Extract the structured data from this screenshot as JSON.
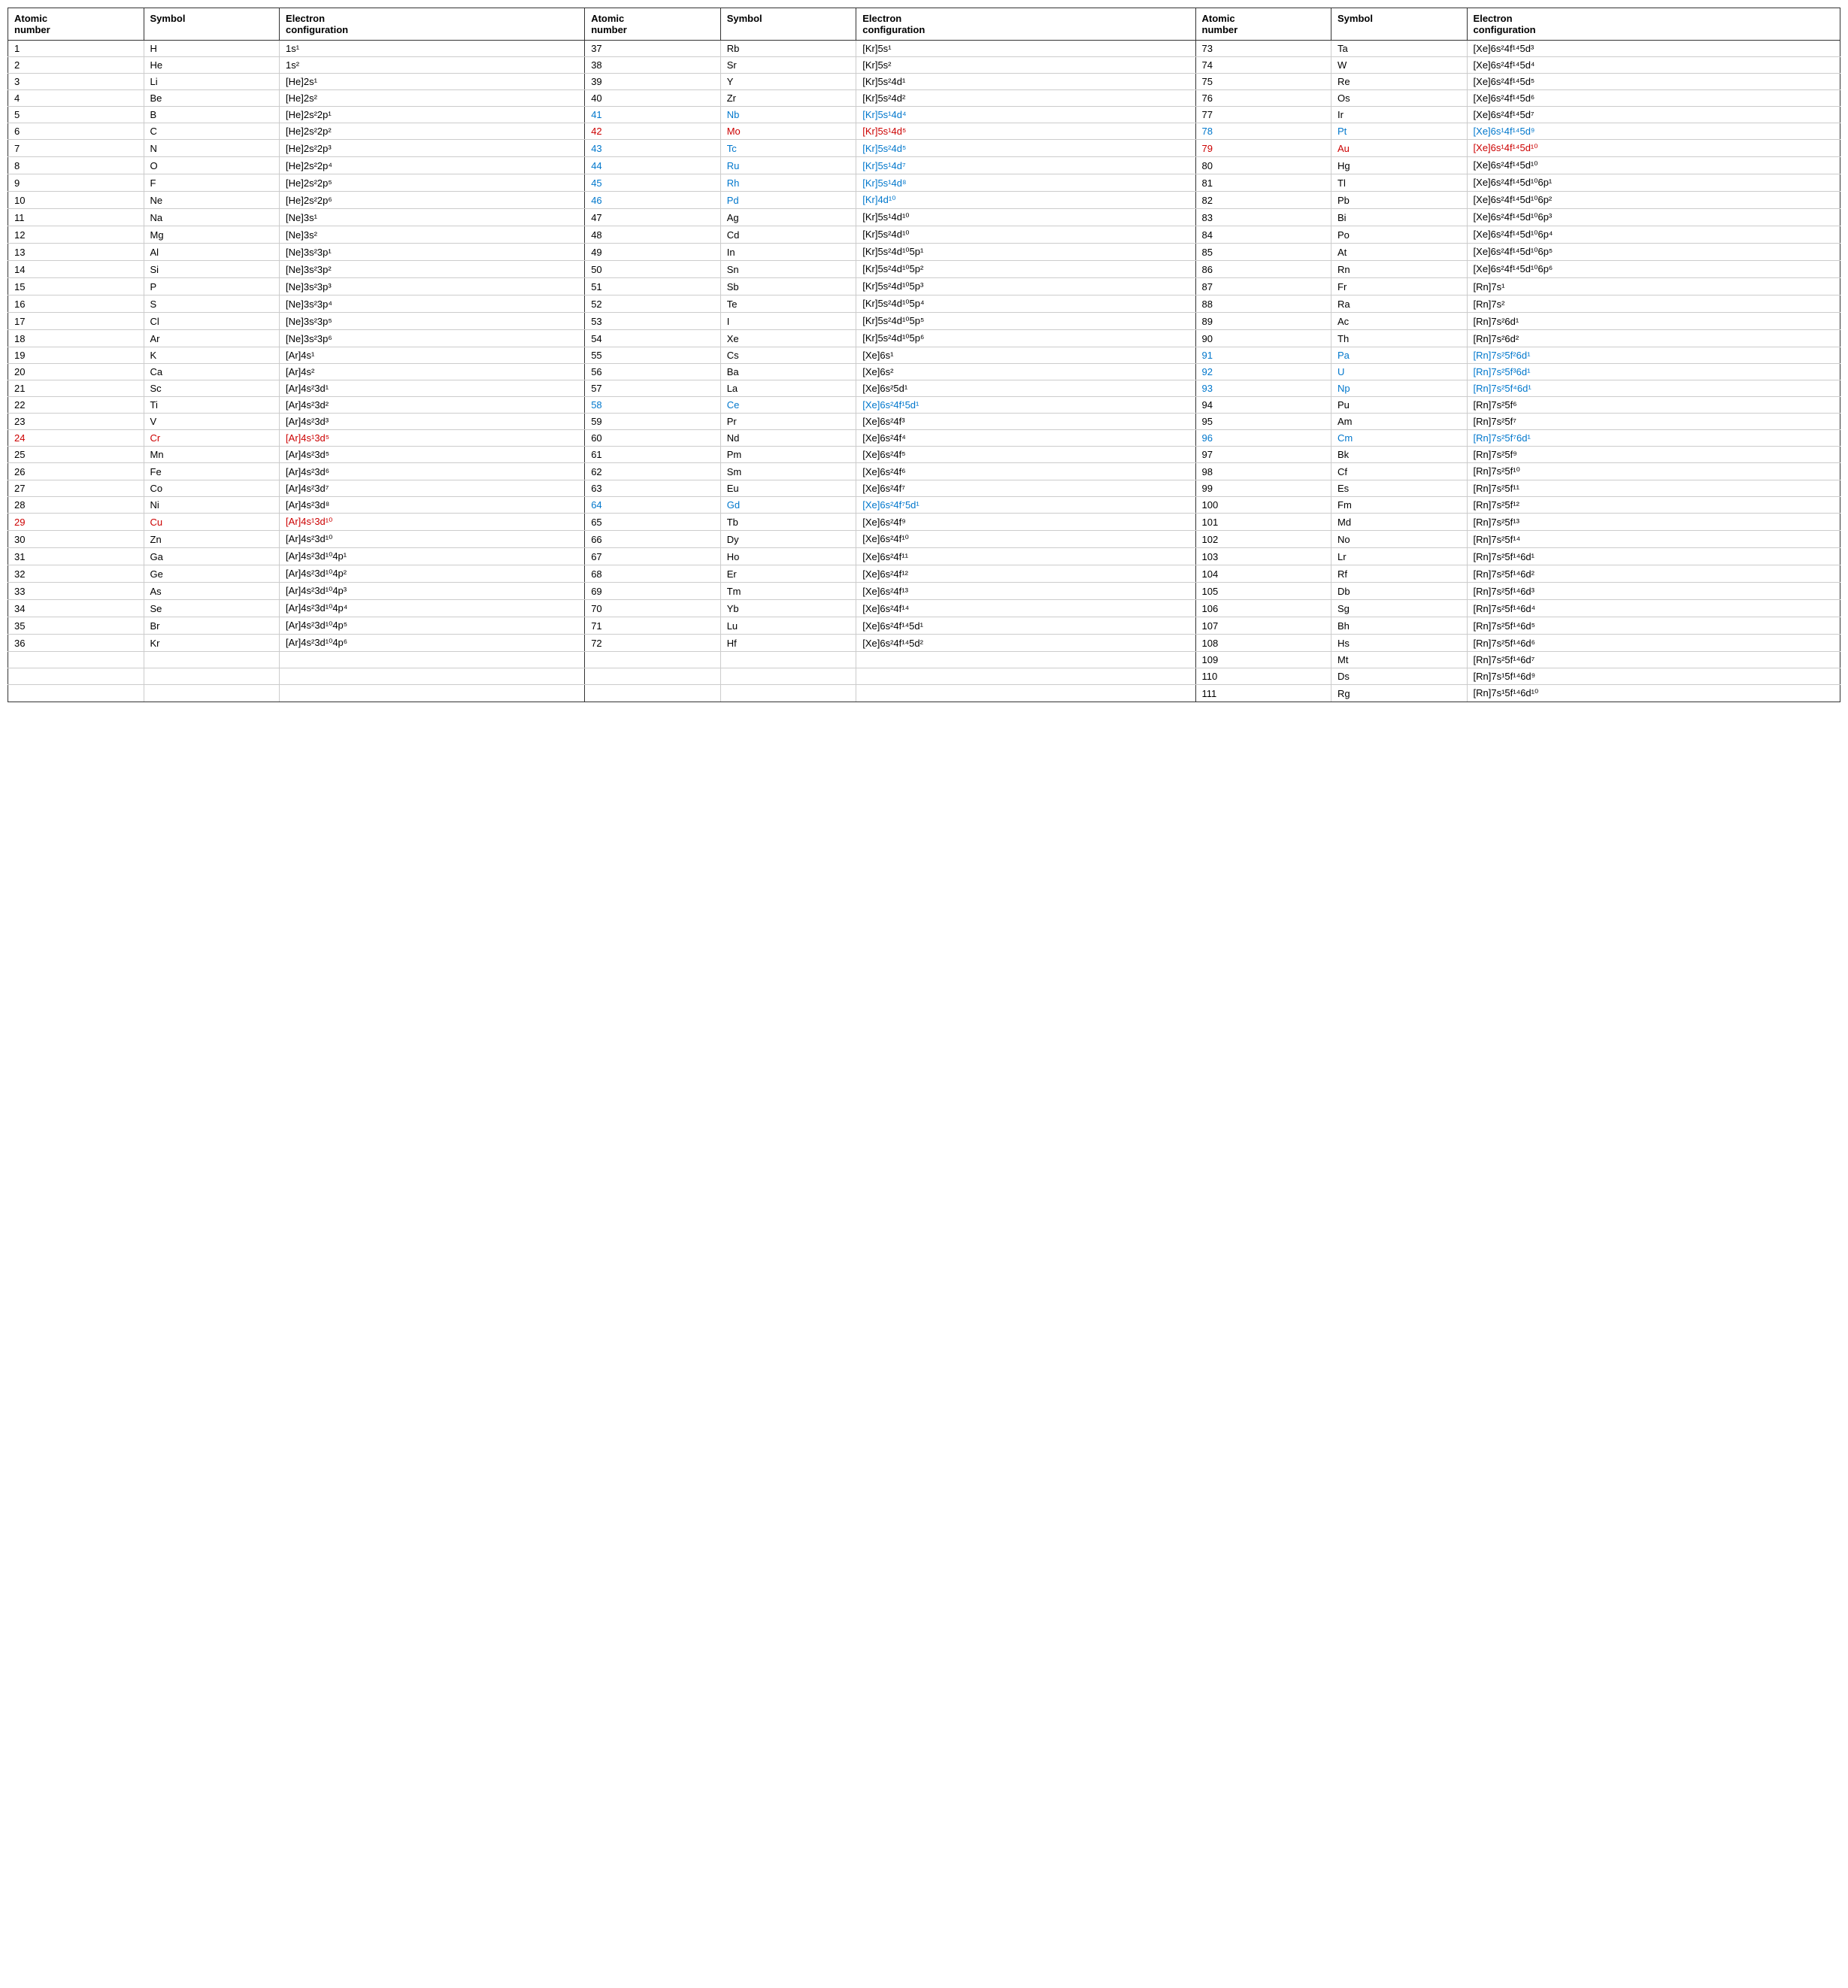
{
  "headers": {
    "col1": [
      "Atomic number",
      "Symbol",
      "Electron configuration"
    ],
    "col2": [
      "Atomic number",
      "Symbol",
      "Electron configuration"
    ],
    "col3": [
      "Atomic number",
      "Symbol",
      "Electron configuration"
    ]
  },
  "rows": [
    {
      "n1": "1",
      "s1": "H",
      "e1": "1s¹",
      "n2": "37",
      "s2": "Rb",
      "e2": "[Kr]5s¹",
      "n3": "73",
      "s3": "Ta",
      "e3": "[Xe]6s²4f¹⁴5d³",
      "c1": "normal",
      "c2": "normal",
      "c3": "normal"
    },
    {
      "n1": "2",
      "s1": "He",
      "e1": "1s²",
      "n2": "38",
      "s2": "Sr",
      "e2": "[Kr]5s²",
      "n3": "74",
      "s3": "W",
      "e3": "[Xe]6s²4f¹⁴5d⁴",
      "c1": "normal",
      "c2": "normal",
      "c3": "normal"
    },
    {
      "n1": "3",
      "s1": "Li",
      "e1": "[He]2s¹",
      "n2": "39",
      "s2": "Y",
      "e2": "[Kr]5s²4d¹",
      "n3": "75",
      "s3": "Re",
      "e3": "[Xe]6s²4f¹⁴5d⁵",
      "c1": "normal",
      "c2": "normal",
      "c3": "normal"
    },
    {
      "n1": "4",
      "s1": "Be",
      "e1": "[He]2s²",
      "n2": "40",
      "s2": "Zr",
      "e2": "[Kr]5s²4d²",
      "n3": "76",
      "s3": "Os",
      "e3": "[Xe]6s²4f¹⁴5d⁶",
      "c1": "normal",
      "c2": "normal",
      "c3": "normal"
    },
    {
      "n1": "5",
      "s1": "B",
      "e1": "[He]2s²2p¹",
      "n2": "41",
      "s2": "Nb",
      "e2": "[Kr]5s¹4d⁴",
      "n3": "77",
      "s3": "Ir",
      "e3": "[Xe]6s²4f¹⁴5d⁷",
      "c1": "normal",
      "c2": "blue",
      "c3": "normal"
    },
    {
      "n1": "6",
      "s1": "C",
      "e1": "[He]2s²2p²",
      "n2": "42",
      "s2": "Mo",
      "e2": "[Kr]5s¹4d⁵",
      "n3": "78",
      "s3": "Pt",
      "e3": "[Xe]6s¹4f¹⁴5d⁹",
      "c1": "normal",
      "c2": "red",
      "c3": "blue"
    },
    {
      "n1": "7",
      "s1": "N",
      "e1": "[He]2s²2p³",
      "n2": "43",
      "s2": "Tc",
      "e2": "[Kr]5s²4d⁵",
      "n3": "79",
      "s3": "Au",
      "e3": "[Xe]6s¹4f¹⁴5d¹⁰",
      "c1": "normal",
      "c2": "blue",
      "c3": "red"
    },
    {
      "n1": "8",
      "s1": "O",
      "e1": "[He]2s²2p⁴",
      "n2": "44",
      "s2": "Ru",
      "e2": "[Kr]5s¹4d⁷",
      "n3": "80",
      "s3": "Hg",
      "e3": "[Xe]6s²4f¹⁴5d¹⁰",
      "c1": "normal",
      "c2": "blue",
      "c3": "normal"
    },
    {
      "n1": "9",
      "s1": "F",
      "e1": "[He]2s²2p⁵",
      "n2": "45",
      "s2": "Rh",
      "e2": "[Kr]5s¹4d⁸",
      "n3": "81",
      "s3": "Tl",
      "e3": "[Xe]6s²4f¹⁴5d¹⁰6p¹",
      "c1": "normal",
      "c2": "blue",
      "c3": "normal"
    },
    {
      "n1": "10",
      "s1": "Ne",
      "e1": "[He]2s²2p⁶",
      "n2": "46",
      "s2": "Pd",
      "e2": "[Kr]4d¹⁰",
      "n3": "82",
      "s3": "Pb",
      "e3": "[Xe]6s²4f¹⁴5d¹⁰6p²",
      "c1": "normal",
      "c2": "blue",
      "c3": "normal"
    },
    {
      "n1": "11",
      "s1": "Na",
      "e1": "[Ne]3s¹",
      "n2": "47",
      "s2": "Ag",
      "e2": "[Kr]5s¹4d¹⁰",
      "n3": "83",
      "s3": "Bi",
      "e3": "[Xe]6s²4f¹⁴5d¹⁰6p³",
      "c1": "normal",
      "c2": "normal",
      "c3": "normal"
    },
    {
      "n1": "12",
      "s1": "Mg",
      "e1": "[Ne]3s²",
      "n2": "48",
      "s2": "Cd",
      "e2": "[Kr]5s²4d¹⁰",
      "n3": "84",
      "s3": "Po",
      "e3": "[Xe]6s²4f¹⁴5d¹⁰6p⁴",
      "c1": "normal",
      "c2": "normal",
      "c3": "normal"
    },
    {
      "n1": "13",
      "s1": "Al",
      "e1": "[Ne]3s²3p¹",
      "n2": "49",
      "s2": "In",
      "e2": "[Kr]5s²4d¹⁰5p¹",
      "n3": "85",
      "s3": "At",
      "e3": "[Xe]6s²4f¹⁴5d¹⁰6p⁵",
      "c1": "normal",
      "c2": "normal",
      "c3": "normal"
    },
    {
      "n1": "14",
      "s1": "Si",
      "e1": "[Ne]3s²3p²",
      "n2": "50",
      "s2": "Sn",
      "e2": "[Kr]5s²4d¹⁰5p²",
      "n3": "86",
      "s3": "Rn",
      "e3": "[Xe]6s²4f¹⁴5d¹⁰6p⁶",
      "c1": "normal",
      "c2": "normal",
      "c3": "normal"
    },
    {
      "n1": "15",
      "s1": "P",
      "e1": "[Ne]3s²3p³",
      "n2": "51",
      "s2": "Sb",
      "e2": "[Kr]5s²4d¹⁰5p³",
      "n3": "87",
      "s3": "Fr",
      "e3": "[Rn]7s¹",
      "c1": "normal",
      "c2": "normal",
      "c3": "normal"
    },
    {
      "n1": "16",
      "s1": "S",
      "e1": "[Ne]3s²3p⁴",
      "n2": "52",
      "s2": "Te",
      "e2": "[Kr]5s²4d¹⁰5p⁴",
      "n3": "88",
      "s3": "Ra",
      "e3": "[Rn]7s²",
      "c1": "normal",
      "c2": "normal",
      "c3": "normal"
    },
    {
      "n1": "17",
      "s1": "Cl",
      "e1": "[Ne]3s²3p⁵",
      "n2": "53",
      "s2": "I",
      "e2": "[Kr]5s²4d¹⁰5p⁵",
      "n3": "89",
      "s3": "Ac",
      "e3": "[Rn]7s²6d¹",
      "c1": "normal",
      "c2": "normal",
      "c3": "normal"
    },
    {
      "n1": "18",
      "s1": "Ar",
      "e1": "[Ne]3s²3p⁶",
      "n2": "54",
      "s2": "Xe",
      "e2": "[Kr]5s²4d¹⁰5p⁶",
      "n3": "90",
      "s3": "Th",
      "e3": "[Rn]7s²6d²",
      "c1": "normal",
      "c2": "normal",
      "c3": "normal"
    },
    {
      "n1": "19",
      "s1": "K",
      "e1": "[Ar]4s¹",
      "n2": "55",
      "s2": "Cs",
      "e2": "[Xe]6s¹",
      "n3": "91",
      "s3": "Pa",
      "e3": "[Rn]7s²5f²6d¹",
      "c1": "normal",
      "c2": "normal",
      "c3": "blue"
    },
    {
      "n1": "20",
      "s1": "Ca",
      "e1": "[Ar]4s²",
      "n2": "56",
      "s2": "Ba",
      "e2": "[Xe]6s²",
      "n3": "92",
      "s3": "U",
      "e3": "[Rn]7s²5f³6d¹",
      "c1": "normal",
      "c2": "normal",
      "c3": "blue"
    },
    {
      "n1": "21",
      "s1": "Sc",
      "e1": "[Ar]4s²3d¹",
      "n2": "57",
      "s2": "La",
      "e2": "[Xe]6s²5d¹",
      "n3": "93",
      "s3": "Np",
      "e3": "[Rn]7s²5f⁴6d¹",
      "c1": "normal",
      "c2": "normal",
      "c3": "blue"
    },
    {
      "n1": "22",
      "s1": "Ti",
      "e1": "[Ar]4s²3d²",
      "n2": "58",
      "s2": "Ce",
      "e2": "[Xe]6s²4f¹5d¹",
      "n3": "94",
      "s3": "Pu",
      "e3": "[Rn]7s²5f⁶",
      "c1": "normal",
      "c2": "blue",
      "c3": "normal"
    },
    {
      "n1": "23",
      "s1": "V",
      "e1": "[Ar]4s²3d³",
      "n2": "59",
      "s2": "Pr",
      "e2": "[Xe]6s²4f³",
      "n3": "95",
      "s3": "Am",
      "e3": "[Rn]7s²5f⁷",
      "c1": "normal",
      "c2": "normal",
      "c3": "normal"
    },
    {
      "n1": "24",
      "s1": "Cr",
      "e1": "[Ar]4s¹3d⁵",
      "n2": "60",
      "s2": "Nd",
      "e2": "[Xe]6s²4f⁴",
      "n3": "96",
      "s3": "Cm",
      "e3": "[Rn]7s²5f⁷6d¹",
      "c1": "red",
      "c2": "normal",
      "c3": "blue"
    },
    {
      "n1": "25",
      "s1": "Mn",
      "e1": "[Ar]4s²3d⁵",
      "n2": "61",
      "s2": "Pm",
      "e2": "[Xe]6s²4f⁵",
      "n3": "97",
      "s3": "Bk",
      "e3": "[Rn]7s²5f⁹",
      "c1": "normal",
      "c2": "normal",
      "c3": "normal"
    },
    {
      "n1": "26",
      "s1": "Fe",
      "e1": "[Ar]4s²3d⁶",
      "n2": "62",
      "s2": "Sm",
      "e2": "[Xe]6s²4f⁶",
      "n3": "98",
      "s3": "Cf",
      "e3": "[Rn]7s²5f¹⁰",
      "c1": "normal",
      "c2": "normal",
      "c3": "normal"
    },
    {
      "n1": "27",
      "s1": "Co",
      "e1": "[Ar]4s²3d⁷",
      "n2": "63",
      "s2": "Eu",
      "e2": "[Xe]6s²4f⁷",
      "n3": "99",
      "s3": "Es",
      "e3": "[Rn]7s²5f¹¹",
      "c1": "normal",
      "c2": "normal",
      "c3": "normal"
    },
    {
      "n1": "28",
      "s1": "Ni",
      "e1": "[Ar]4s²3d⁸",
      "n2": "64",
      "s2": "Gd",
      "e2": "[Xe]6s²4f⁷5d¹",
      "n3": "100",
      "s3": "Fm",
      "e3": "[Rn]7s²5f¹²",
      "c1": "normal",
      "c2": "blue",
      "c3": "normal"
    },
    {
      "n1": "29",
      "s1": "Cu",
      "e1": "[Ar]4s¹3d¹⁰",
      "n2": "65",
      "s2": "Tb",
      "e2": "[Xe]6s²4f⁹",
      "n3": "101",
      "s3": "Md",
      "e3": "[Rn]7s²5f¹³",
      "c1": "red",
      "c2": "normal",
      "c3": "normal"
    },
    {
      "n1": "30",
      "s1": "Zn",
      "e1": "[Ar]4s²3d¹⁰",
      "n2": "66",
      "s2": "Dy",
      "e2": "[Xe]6s²4f¹⁰",
      "n3": "102",
      "s3": "No",
      "e3": "[Rn]7s²5f¹⁴",
      "c1": "normal",
      "c2": "normal",
      "c3": "normal"
    },
    {
      "n1": "31",
      "s1": "Ga",
      "e1": "[Ar]4s²3d¹⁰4p¹",
      "n2": "67",
      "s2": "Ho",
      "e2": "[Xe]6s²4f¹¹",
      "n3": "103",
      "s3": "Lr",
      "e3": "[Rn]7s²5f¹⁴6d¹",
      "c1": "normal",
      "c2": "normal",
      "c3": "normal"
    },
    {
      "n1": "32",
      "s1": "Ge",
      "e1": "[Ar]4s²3d¹⁰4p²",
      "n2": "68",
      "s2": "Er",
      "e2": "[Xe]6s²4f¹²",
      "n3": "104",
      "s3": "Rf",
      "e3": "[Rn]7s²5f¹⁴6d²",
      "c1": "normal",
      "c2": "normal",
      "c3": "normal"
    },
    {
      "n1": "33",
      "s1": "As",
      "e1": "[Ar]4s²3d¹⁰4p³",
      "n2": "69",
      "s2": "Tm",
      "e2": "[Xe]6s²4f¹³",
      "n3": "105",
      "s3": "Db",
      "e3": "[Rn]7s²5f¹⁴6d³",
      "c1": "normal",
      "c2": "normal",
      "c3": "normal"
    },
    {
      "n1": "34",
      "s1": "Se",
      "e1": "[Ar]4s²3d¹⁰4p⁴",
      "n2": "70",
      "s2": "Yb",
      "e2": "[Xe]6s²4f¹⁴",
      "n3": "106",
      "s3": "Sg",
      "e3": "[Rn]7s²5f¹⁴6d⁴",
      "c1": "normal",
      "c2": "normal",
      "c3": "normal"
    },
    {
      "n1": "35",
      "s1": "Br",
      "e1": "[Ar]4s²3d¹⁰4p⁵",
      "n2": "71",
      "s2": "Lu",
      "e2": "[Xe]6s²4f¹⁴5d¹",
      "n3": "107",
      "s3": "Bh",
      "e3": "[Rn]7s²5f¹⁴6d⁵",
      "c1": "normal",
      "c2": "normal",
      "c3": "normal"
    },
    {
      "n1": "36",
      "s1": "Kr",
      "e1": "[Ar]4s²3d¹⁰4p⁶",
      "n2": "72",
      "s2": "Hf",
      "e2": "[Xe]6s²4f¹⁴5d²",
      "n3": "108",
      "s3": "Hs",
      "e3": "[Rn]7s²5f¹⁴6d⁶",
      "c1": "normal",
      "c2": "normal",
      "c3": "normal"
    },
    {
      "n1": "",
      "s1": "",
      "e1": "",
      "n2": "",
      "s2": "",
      "e2": "",
      "n3": "109",
      "s3": "Mt",
      "e3": "[Rn]7s²5f¹⁴6d⁷",
      "c1": "normal",
      "c2": "normal",
      "c3": "normal"
    },
    {
      "n1": "",
      "s1": "",
      "e1": "",
      "n2": "",
      "s2": "",
      "e2": "",
      "n3": "110",
      "s3": "Ds",
      "e3": "[Rn]7s¹5f¹⁴6d⁹",
      "c1": "normal",
      "c2": "normal",
      "c3": "normal"
    },
    {
      "n1": "",
      "s1": "",
      "e1": "",
      "n2": "",
      "s2": "",
      "e2": "",
      "n3": "111",
      "s3": "Rg",
      "e3": "[Rn]7s¹5f¹⁴6d¹⁰",
      "c1": "normal",
      "c2": "normal",
      "c3": "normal"
    }
  ]
}
